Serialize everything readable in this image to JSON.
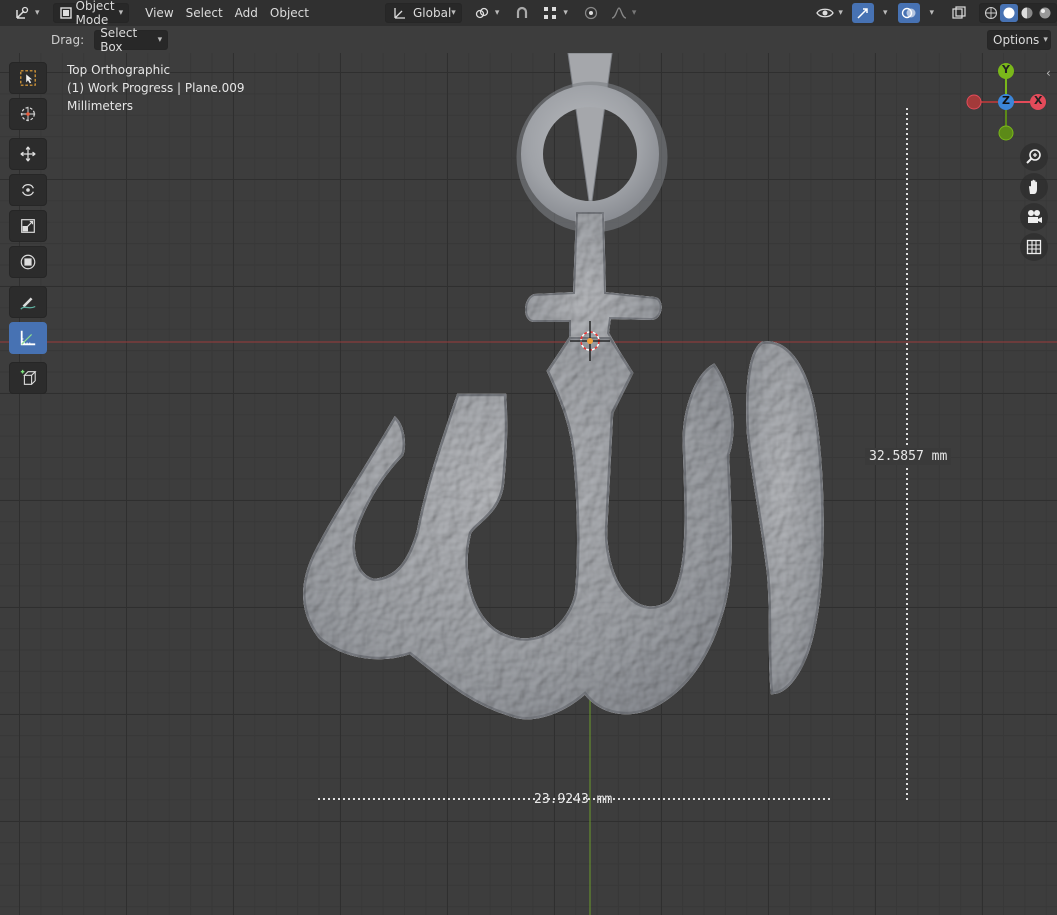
{
  "header": {
    "editor_type_icon": "orientation-icon",
    "mode": "Object Mode",
    "menus": [
      "View",
      "Select",
      "Add",
      "Object"
    ],
    "transform_orientation": "Global",
    "shading_modes": [
      "wireframe",
      "solid",
      "material",
      "rendered"
    ]
  },
  "tool_header": {
    "drag_label": "Drag:",
    "drag_value": "Select Box",
    "options_label": "Options"
  },
  "viewport": {
    "view_name": "Top Orthographic",
    "collection_object": "(1) Work Progress | Plane.009",
    "units": "Millimeters"
  },
  "measurements": {
    "height": "32.5857 mm",
    "width": "23.9243 mm"
  },
  "gizmo": {
    "x_label": "X",
    "y_label": "Y",
    "z_label": "Z",
    "colors": {
      "x": "#e44b5a",
      "y": "#7ab81a",
      "z": "#3c86d9"
    }
  },
  "colors": {
    "accent": "#4772b3",
    "object": "#a7a9ad",
    "x_axis": "#a33a3a",
    "y_axis": "#6a9a2a"
  }
}
